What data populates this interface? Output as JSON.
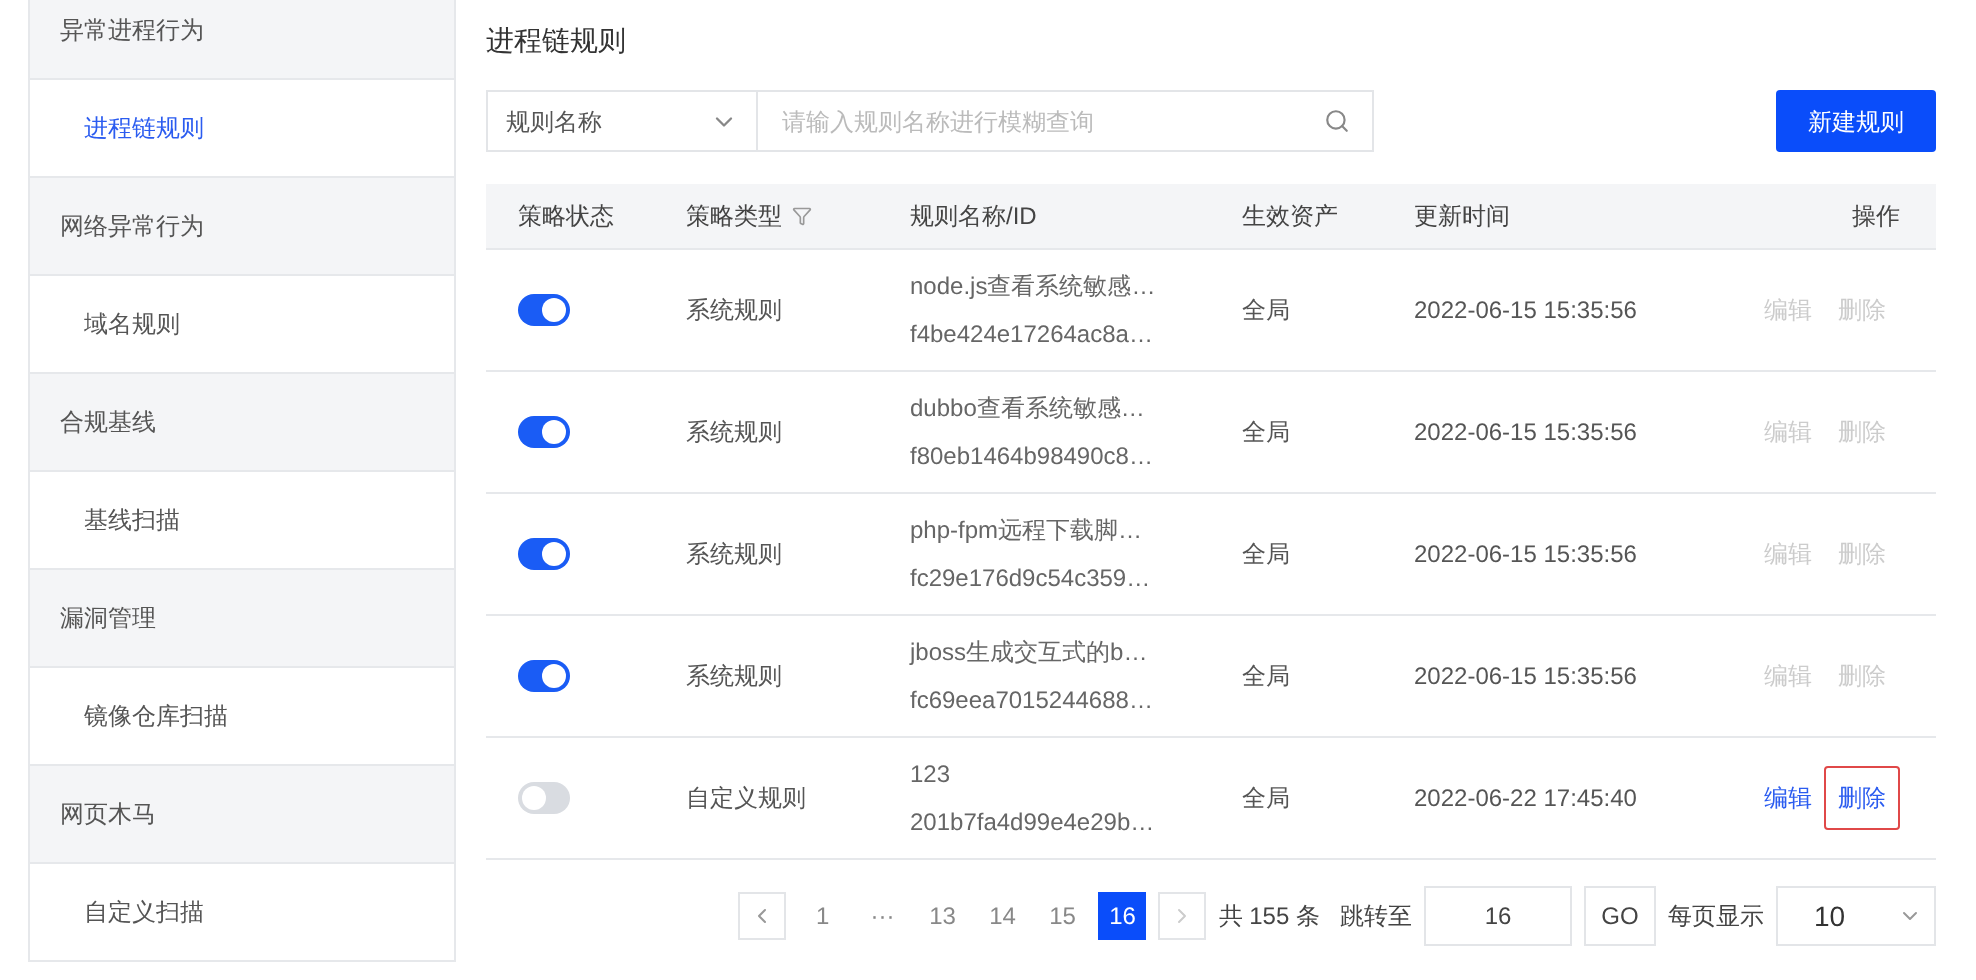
{
  "sidebar": {
    "items": [
      {
        "label": "异常进程行为",
        "kind": "group",
        "selected": false
      },
      {
        "label": "进程链规则",
        "kind": "child",
        "selected": true
      },
      {
        "label": "网络异常行为",
        "kind": "group",
        "selected": false
      },
      {
        "label": "域名规则",
        "kind": "child",
        "selected": false
      },
      {
        "label": "合规基线",
        "kind": "group",
        "selected": false
      },
      {
        "label": "基线扫描",
        "kind": "child",
        "selected": false
      },
      {
        "label": "漏洞管理",
        "kind": "group",
        "selected": false
      },
      {
        "label": "镜像仓库扫描",
        "kind": "child",
        "selected": false
      },
      {
        "label": "网页木马",
        "kind": "group",
        "selected": false
      },
      {
        "label": "自定义扫描",
        "kind": "child",
        "selected": false
      }
    ]
  },
  "page_title": "进程链规则",
  "search": {
    "select_value": "规则名称",
    "placeholder": "请输入规则名称进行模糊查询"
  },
  "new_button": "新建规则",
  "table": {
    "columns": [
      "策略状态",
      "策略类型",
      "规则名称/ID",
      "生效资产",
      "更新时间",
      "操作"
    ],
    "rows": [
      {
        "on": true,
        "type": "系统规则",
        "name": "node.js查看系统敏感…",
        "id": "f4be424e17264ac8a…",
        "scope": "全局",
        "time": "2022-06-15 15:35:56",
        "edit": "编辑",
        "delete": "删除",
        "actions_enabled": false,
        "delete_highlighted": false
      },
      {
        "on": true,
        "type": "系统规则",
        "name": "dubbo查看系统敏感…",
        "id": "f80eb1464b98490c8…",
        "scope": "全局",
        "time": "2022-06-15 15:35:56",
        "edit": "编辑",
        "delete": "删除",
        "actions_enabled": false,
        "delete_highlighted": false
      },
      {
        "on": true,
        "type": "系统规则",
        "name": "php-fpm远程下载脚…",
        "id": "fc29e176d9c54c359…",
        "scope": "全局",
        "time": "2022-06-15 15:35:56",
        "edit": "编辑",
        "delete": "删除",
        "actions_enabled": false,
        "delete_highlighted": false
      },
      {
        "on": true,
        "type": "系统规则",
        "name": "jboss生成交互式的b…",
        "id": "fc69eea7015244688…",
        "scope": "全局",
        "time": "2022-06-15 15:35:56",
        "edit": "编辑",
        "delete": "删除",
        "actions_enabled": false,
        "delete_highlighted": false
      },
      {
        "on": false,
        "type": "自定义规则",
        "name": "123",
        "id": "201b7fa4d99e4e29b…",
        "scope": "全局",
        "time": "2022-06-22 17:45:40",
        "edit": "编辑",
        "delete": "删除",
        "actions_enabled": true,
        "delete_highlighted": true
      }
    ]
  },
  "pagination": {
    "pages": [
      {
        "label": "1",
        "selected": false
      },
      {
        "label": "···",
        "selected": false
      },
      {
        "label": "13",
        "selected": false
      },
      {
        "label": "14",
        "selected": false
      },
      {
        "label": "15",
        "selected": false
      },
      {
        "label": "16",
        "selected": true
      }
    ],
    "total": "共 155 条",
    "jump_label": "跳转至",
    "jump_value": "16",
    "go": "GO",
    "per_page_label": "每页显示",
    "per_page": "10"
  }
}
